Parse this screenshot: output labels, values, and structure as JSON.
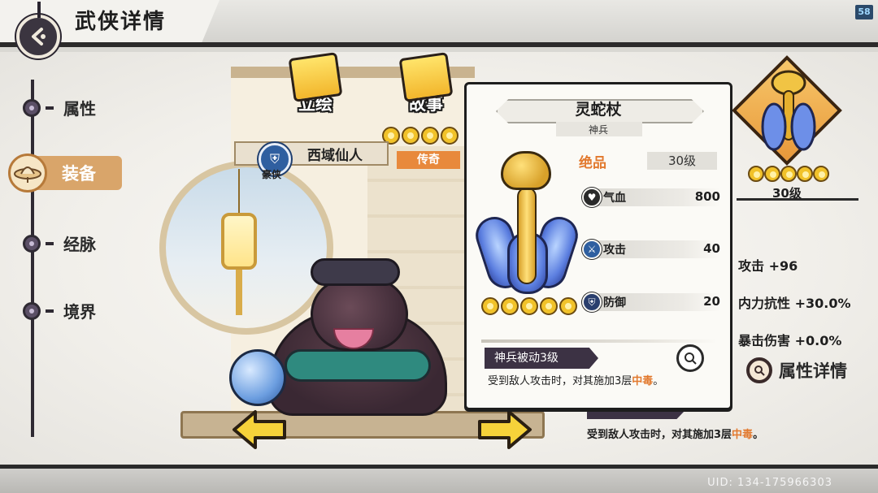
{
  "header": {
    "title": "武侠详情",
    "fps": "58"
  },
  "nav": {
    "items": [
      {
        "label": "属性"
      },
      {
        "label": "装备"
      },
      {
        "label": "经脉"
      },
      {
        "label": "境界"
      }
    ],
    "active_index": 1
  },
  "stage": {
    "tabs": [
      {
        "label": "立绘",
        "icon": "portrait-scroll-icon"
      },
      {
        "label": "故事",
        "icon": "story-book-icon"
      }
    ],
    "hero_name": "西域仙人",
    "sect_label": "豪侠",
    "rarity": "传奇",
    "star_count": 5
  },
  "weapon_panel": {
    "name": "灵蛇杖",
    "category": "神兵",
    "quality": "绝品",
    "level": "30级",
    "stats": [
      {
        "name": "气血",
        "value": "800",
        "icon": "heart-icon"
      },
      {
        "name": "攻击",
        "value": "40",
        "icon": "sword-icon"
      },
      {
        "name": "防御",
        "value": "20",
        "icon": "shield-icon"
      }
    ],
    "star_count": 5,
    "passive_title": "神兵被动3级",
    "passive_desc_prefix": "受到敌人攻击时，对其施加3层",
    "passive_desc_highlight": "中毒",
    "passive_desc_suffix": "。"
  },
  "right_info": {
    "weapon_level": "30级",
    "star_count": 5,
    "bonuses": [
      {
        "label": "攻击",
        "value": "+96"
      },
      {
        "label": "内力抗性",
        "value": "+30.0%"
      },
      {
        "label": "暴击伤害",
        "value": "+0.0%"
      }
    ],
    "detail_button": "属性详情",
    "behind_desc_prefix": "受到敌人攻击时，对其施加3层",
    "behind_desc_highlight": "中毒",
    "behind_desc_suffix": "。"
  },
  "footer": {
    "uid": "UID: 134-175966303"
  },
  "colors": {
    "accent_orange": "#e2792e",
    "nav_active": "#d9a56a",
    "passive_tag": "#3c3244"
  }
}
